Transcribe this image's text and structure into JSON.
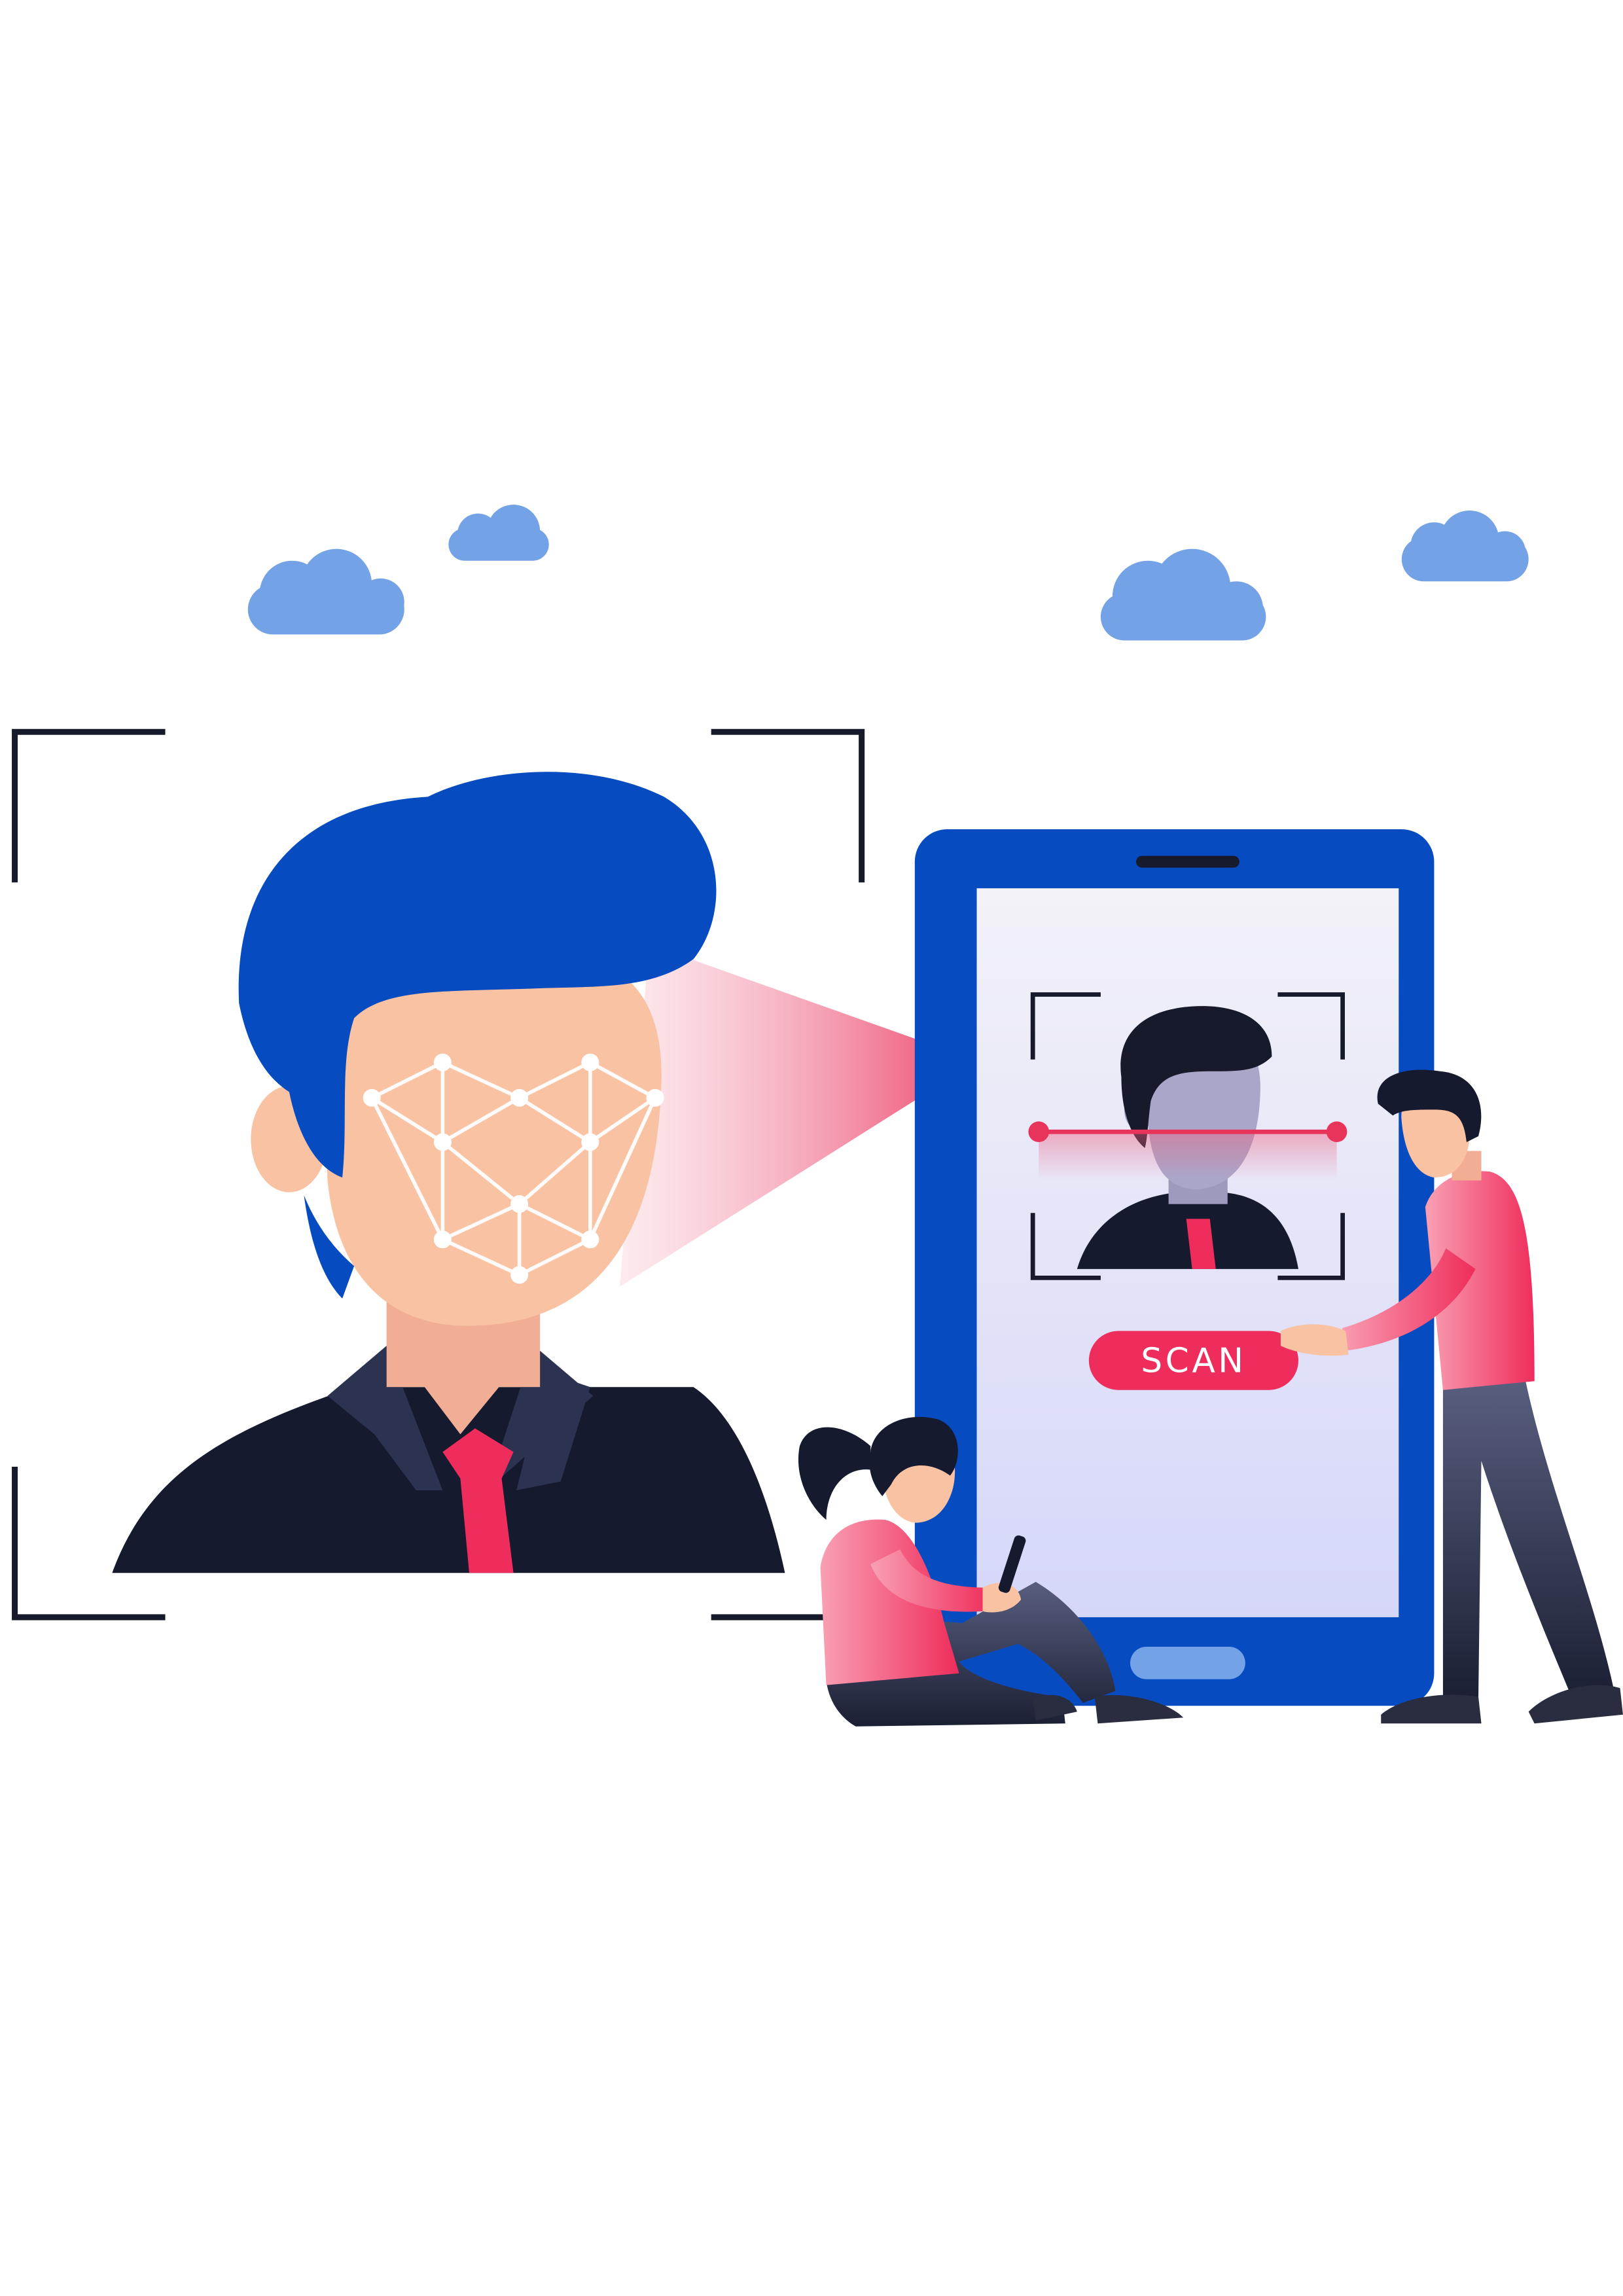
{
  "colors": {
    "background": "#ffffff",
    "cloud": "#74a2e6",
    "hair_blue": "#074bc0",
    "phone_body": "#074bc0",
    "phone_screen_top": "#f2f1f7",
    "phone_screen_bottom": "#d6d7f8",
    "skin": "#f9c2a3",
    "skin_shadow": "#efa68a",
    "shirt_dark": "#151a2e",
    "collar": "#2c3350",
    "accent_red": "#ef2d5c",
    "mesh_white": "#ffffff",
    "scan_line": "#e8335a",
    "frame_dark": "#161a2a",
    "mini_head": "#a9a7c9",
    "pants_dark": "#1f2238"
  },
  "phone": {
    "scan_button_label": "SCAN"
  },
  "icons": {
    "clouds": "cloud-icon",
    "face_mesh": "face-mesh-icon",
    "scan_frame": "scan-frame-icon"
  }
}
